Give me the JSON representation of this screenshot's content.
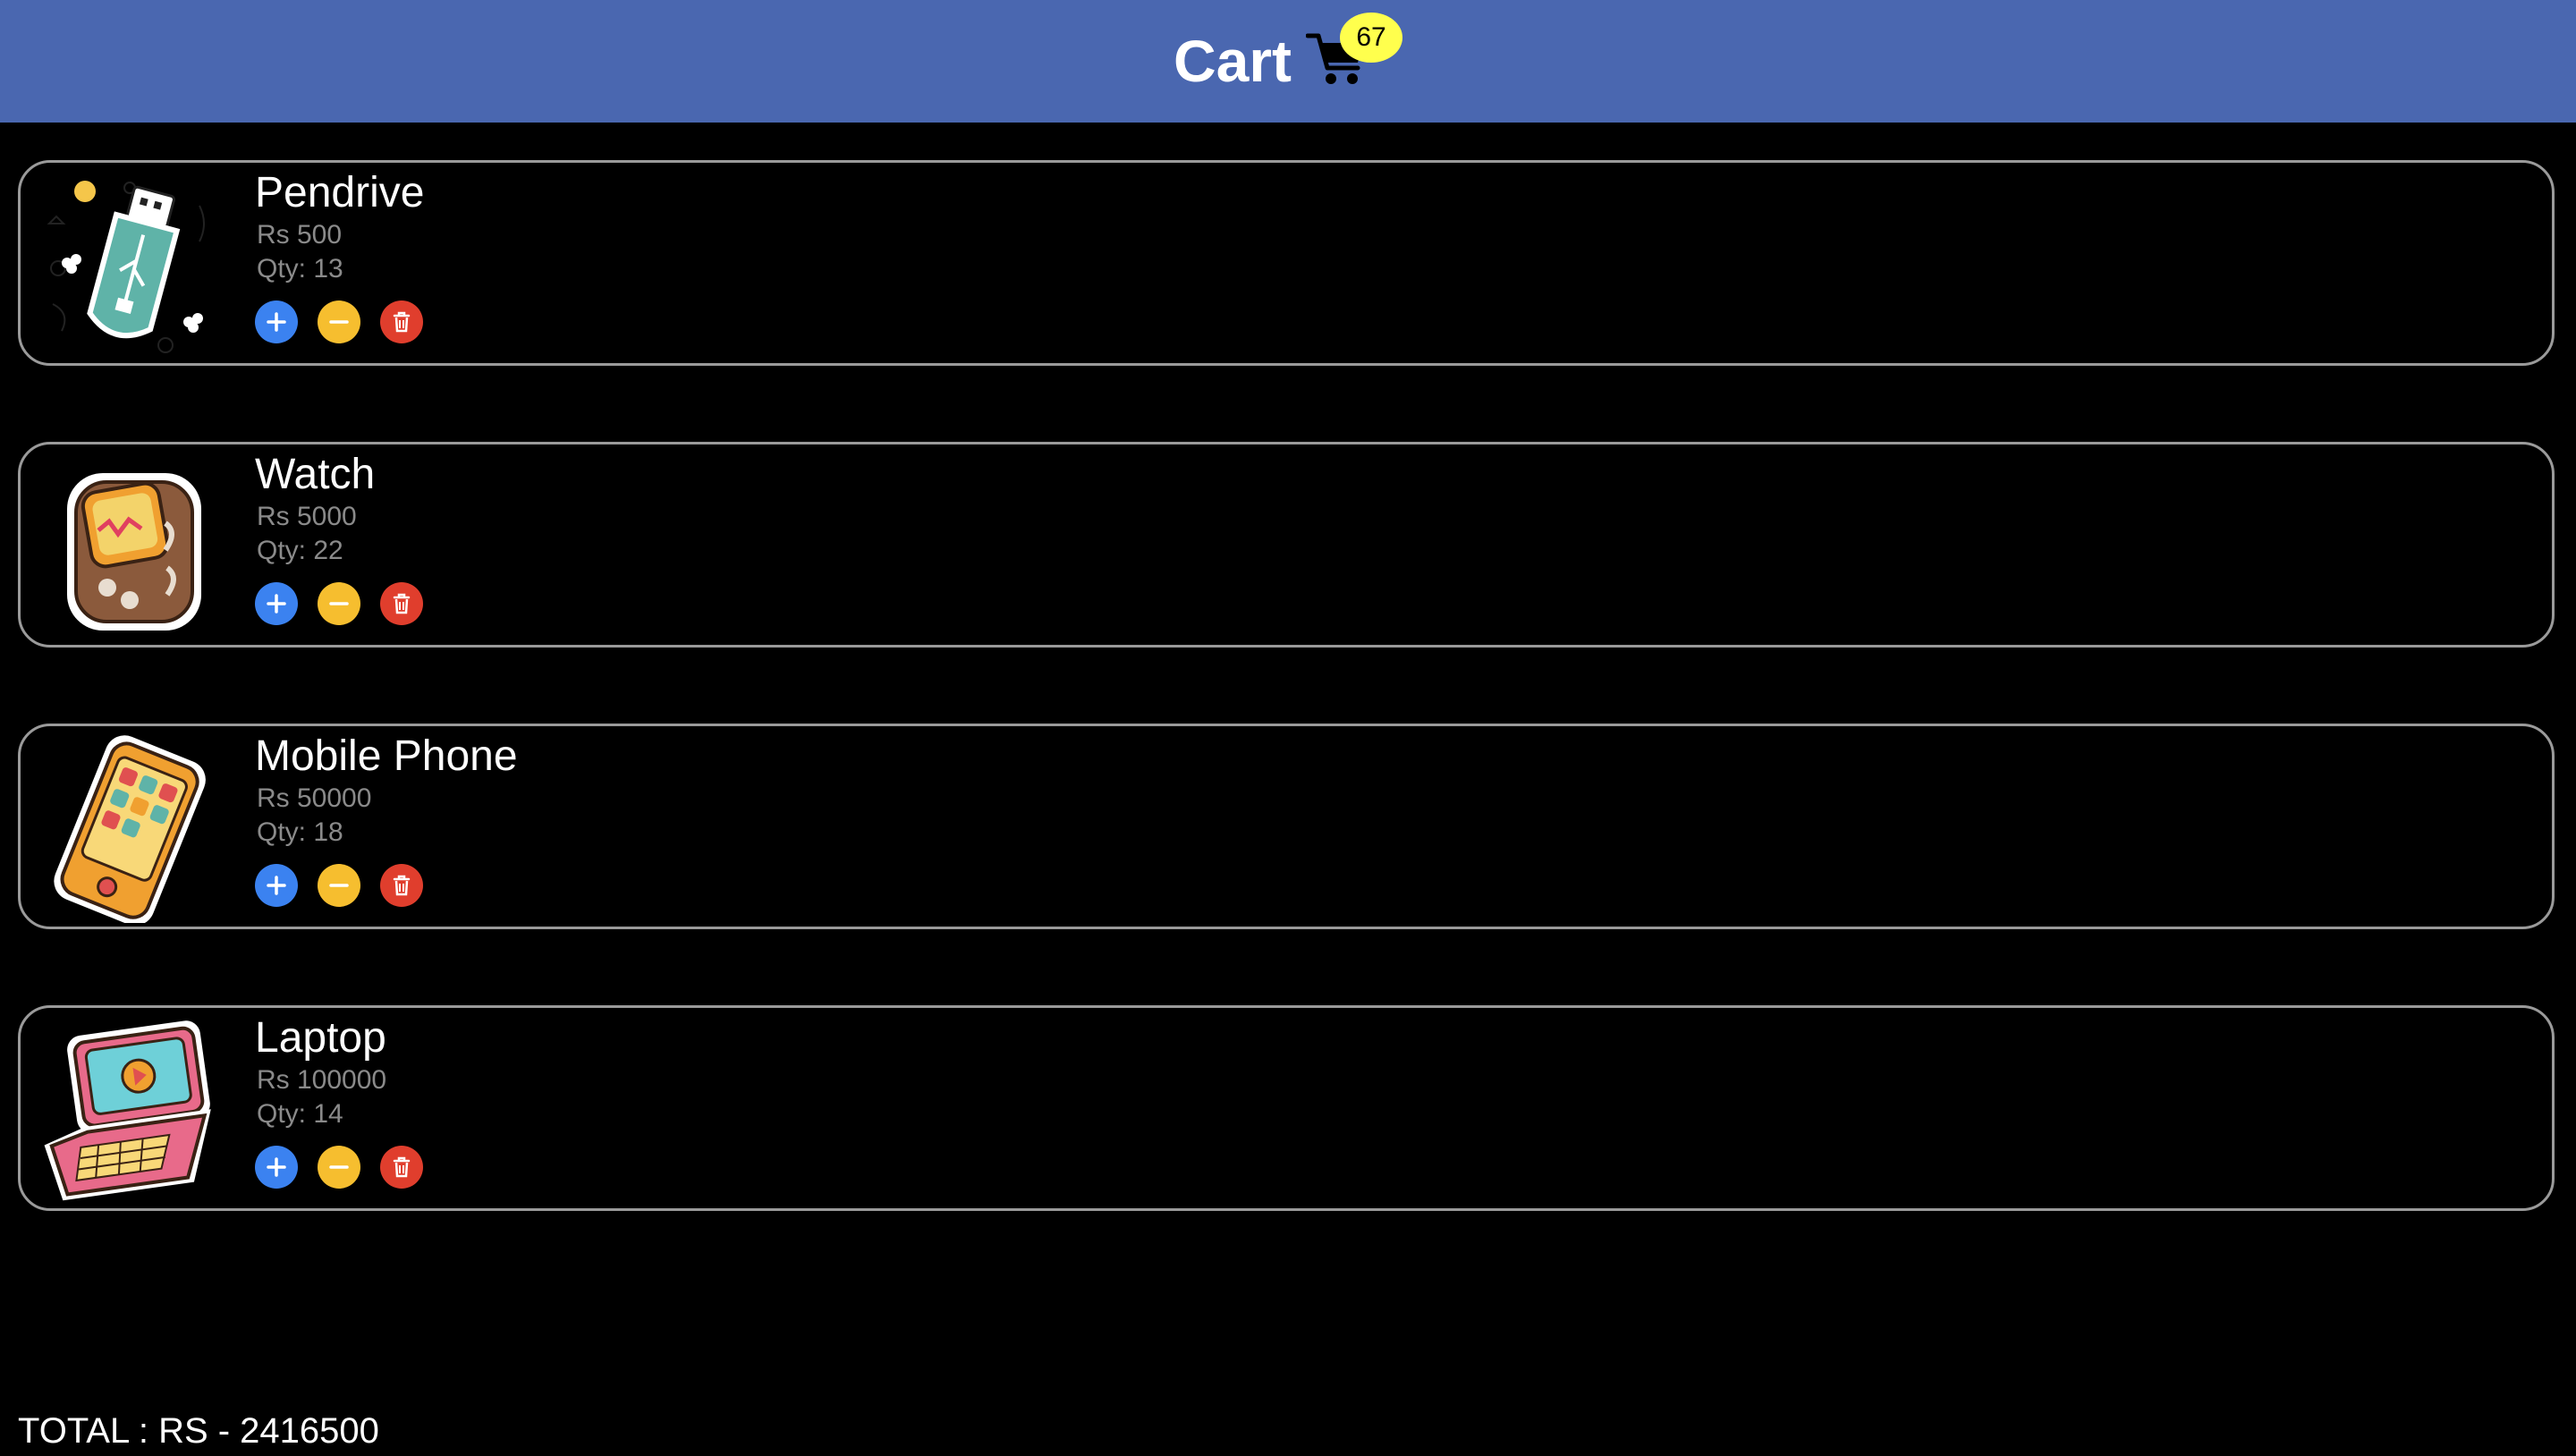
{
  "header": {
    "title": "Cart",
    "cart_count": "67",
    "background_color": "#4a67b0",
    "badge_color": "#ffff4d"
  },
  "items": [
    {
      "name": "Pendrive",
      "price": "Rs 500",
      "qty": "Qty: 13",
      "image_icon": "pendrive-sticker"
    },
    {
      "name": "Watch",
      "price": "Rs 5000",
      "qty": "Qty: 22",
      "image_icon": "watch-sticker"
    },
    {
      "name": "Mobile Phone",
      "price": "Rs 50000",
      "qty": "Qty: 18",
      "image_icon": "mobile-phone-sticker"
    },
    {
      "name": "Laptop",
      "price": "Rs 100000",
      "qty": "Qty: 14",
      "image_icon": "laptop-sticker"
    }
  ],
  "actions": {
    "increase_icon": "plus-icon",
    "decrease_icon": "minus-icon",
    "delete_icon": "trash-icon",
    "increase_color": "#3b82f0",
    "decrease_color": "#f6be2f",
    "delete_color": "#e03e2d"
  },
  "total": "TOTAL : RS - 2416500"
}
